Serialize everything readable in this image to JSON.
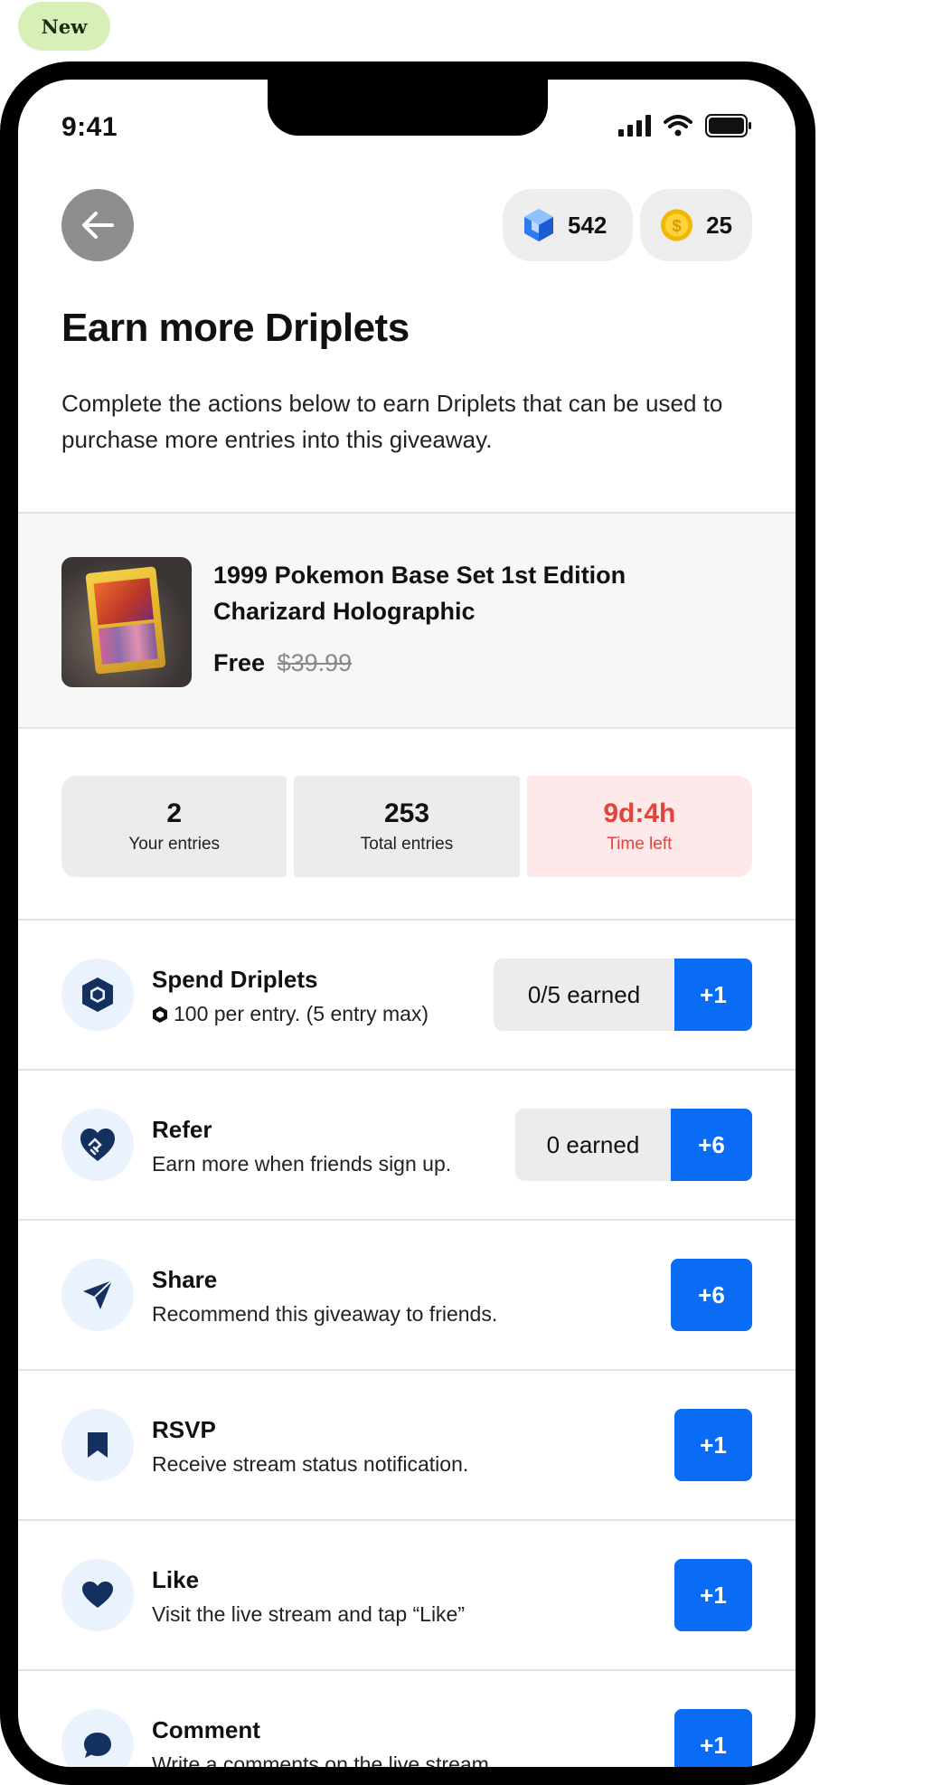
{
  "badge": "New",
  "status": {
    "time": "9:41"
  },
  "balances": {
    "driplets": "542",
    "coins": "25"
  },
  "header": {
    "title": "Earn more Driplets",
    "subtitle": "Complete the actions below to earn Driplets that can be used to purchase more entries into this giveaway."
  },
  "product": {
    "name": "1999 Pokemon Base Set 1st Edition Charizard Holographic",
    "price": "Free",
    "original_price": "$39.99"
  },
  "stats": [
    {
      "value": "2",
      "label": "Your entries"
    },
    {
      "value": "253",
      "label": "Total entries"
    },
    {
      "value": "9d:4h",
      "label": "Time left"
    }
  ],
  "actions": {
    "spend": {
      "title": "Spend Driplets",
      "desc": "100 per entry. (5 entry max)",
      "earned": "0/5 earned",
      "reward": "+1"
    },
    "refer": {
      "title": "Refer",
      "desc": "Earn more when friends sign up.",
      "earned": "0 earned",
      "reward": "+6"
    },
    "share": {
      "title": "Share",
      "desc": "Recommend this giveaway to friends.",
      "reward": "+6"
    },
    "rsvp": {
      "title": "RSVP",
      "desc": "Receive stream status notification.",
      "reward": "+1"
    },
    "like": {
      "title": "Like",
      "desc": "Visit the live stream and tap “Like”",
      "reward": "+1"
    },
    "comment": {
      "title": "Comment",
      "desc": "Write a comments on the live stream.",
      "reward": "+1"
    }
  },
  "colors": {
    "accent": "#0a6cf5",
    "icon_navy": "#14305e",
    "time_left_red": "#e0443a",
    "badge_green": "#d6f0b8"
  }
}
